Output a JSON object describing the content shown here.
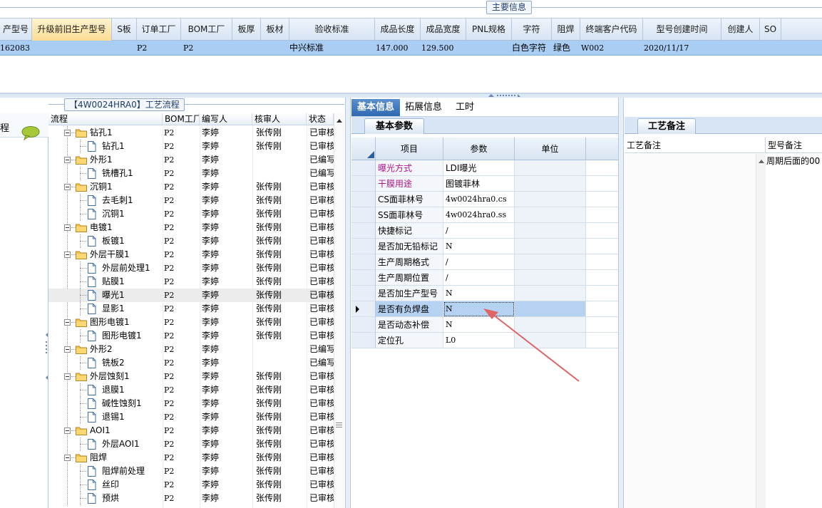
{
  "main_info": {
    "title": "主要信息",
    "columns": [
      {
        "label": "产型号"
      },
      {
        "label": "升级前旧生产型号"
      },
      {
        "label": "S板"
      },
      {
        "label": "订单工厂"
      },
      {
        "label": "BOM工厂"
      },
      {
        "label": "板厚"
      },
      {
        "label": "板材"
      },
      {
        "label": "验收标准"
      },
      {
        "label": "成品长度"
      },
      {
        "label": "成品宽度"
      },
      {
        "label": "PNL规格"
      },
      {
        "label": "字符"
      },
      {
        "label": "阻焊"
      },
      {
        "label": "终端客户代码"
      },
      {
        "label": "型号创建时间"
      },
      {
        "label": "创建人"
      },
      {
        "label": "SO"
      }
    ],
    "row": [
      "162083",
      "",
      "",
      "P2",
      "P2",
      "",
      "",
      "中兴标准",
      "147.000",
      "129.500",
      "",
      "白色字符",
      "绿色",
      "W002",
      "2020/11/17",
      "",
      ""
    ]
  },
  "left_panel": {
    "label": "程"
  },
  "process_flow": {
    "title": "【4W0024HRA0】工艺流程",
    "headers": [
      "流程",
      "BOM工厂",
      "编写人",
      "核审人",
      "状态"
    ],
    "rows": [
      {
        "name": "钻孔1",
        "level": 0,
        "bom": "P2",
        "writer": "李婷",
        "reviewer": "张传刚",
        "status": "已审核"
      },
      {
        "name": "钻孔1",
        "level": 1,
        "bom": "P2",
        "writer": "李婷",
        "reviewer": "张传刚",
        "status": "已审核"
      },
      {
        "name": "外形1",
        "level": 0,
        "bom": "P2",
        "writer": "李婷",
        "reviewer": "",
        "status": "已编写"
      },
      {
        "name": "铣槽孔1",
        "level": 1,
        "bom": "P2",
        "writer": "李婷",
        "reviewer": "",
        "status": "已编写"
      },
      {
        "name": "沉铜1",
        "level": 0,
        "bom": "P2",
        "writer": "李婷",
        "reviewer": "张传刚",
        "status": "已审核"
      },
      {
        "name": "去毛刺1",
        "level": 1,
        "bom": "P2",
        "writer": "李婷",
        "reviewer": "张传刚",
        "status": "已审核"
      },
      {
        "name": "沉铜1",
        "level": 1,
        "bom": "P2",
        "writer": "李婷",
        "reviewer": "张传刚",
        "status": "已审核"
      },
      {
        "name": "电镀1",
        "level": 0,
        "bom": "P2",
        "writer": "李婷",
        "reviewer": "张传刚",
        "status": "已审核"
      },
      {
        "name": "板镀1",
        "level": 1,
        "bom": "P2",
        "writer": "李婷",
        "reviewer": "张传刚",
        "status": "已审核"
      },
      {
        "name": "外层干膜1",
        "level": 0,
        "bom": "P2",
        "writer": "李婷",
        "reviewer": "张传刚",
        "status": "已审核"
      },
      {
        "name": "外层前处理1",
        "level": 1,
        "bom": "P2",
        "writer": "李婷",
        "reviewer": "张传刚",
        "status": "已审核"
      },
      {
        "name": "贴膜1",
        "level": 1,
        "bom": "P2",
        "writer": "李婷",
        "reviewer": "张传刚",
        "status": "已审核"
      },
      {
        "name": "曝光1",
        "level": 1,
        "bom": "P2",
        "writer": "李婷",
        "reviewer": "张传刚",
        "status": "已审核",
        "selected": true
      },
      {
        "name": "显影1",
        "level": 1,
        "bom": "P2",
        "writer": "李婷",
        "reviewer": "张传刚",
        "status": "已审核"
      },
      {
        "name": "图形电镀1",
        "level": 0,
        "bom": "P2",
        "writer": "李婷",
        "reviewer": "张传刚",
        "status": "已审核"
      },
      {
        "name": "图形电镀1",
        "level": 1,
        "bom": "P2",
        "writer": "李婷",
        "reviewer": "张传刚",
        "status": "已审核"
      },
      {
        "name": "外形2",
        "level": 0,
        "bom": "P2",
        "writer": "李婷",
        "reviewer": "",
        "status": "已编写"
      },
      {
        "name": "铣板2",
        "level": 1,
        "bom": "P2",
        "writer": "李婷",
        "reviewer": "",
        "status": "已编写"
      },
      {
        "name": "外层蚀刻1",
        "level": 0,
        "bom": "P2",
        "writer": "李婷",
        "reviewer": "张传刚",
        "status": "已审核"
      },
      {
        "name": "退膜1",
        "level": 1,
        "bom": "P2",
        "writer": "李婷",
        "reviewer": "张传刚",
        "status": "已审核"
      },
      {
        "name": "碱性蚀刻1",
        "level": 1,
        "bom": "P2",
        "writer": "李婷",
        "reviewer": "张传刚",
        "status": "已审核"
      },
      {
        "name": "退锡1",
        "level": 1,
        "bom": "P2",
        "writer": "李婷",
        "reviewer": "张传刚",
        "status": "已审核"
      },
      {
        "name": "AOI1",
        "level": 0,
        "bom": "P2",
        "writer": "李婷",
        "reviewer": "张传刚",
        "status": "已审核"
      },
      {
        "name": "外层AOI1",
        "level": 1,
        "bom": "P2",
        "writer": "李婷",
        "reviewer": "张传刚",
        "status": "已审核"
      },
      {
        "name": "阻焊",
        "level": 0,
        "bom": "P2",
        "writer": "李婷",
        "reviewer": "张传刚",
        "status": "已审核"
      },
      {
        "name": "阻焊前处理",
        "level": 1,
        "bom": "P2",
        "writer": "李婷",
        "reviewer": "张传刚",
        "status": "已审核"
      },
      {
        "name": "丝印",
        "level": 1,
        "bom": "P2",
        "writer": "李婷",
        "reviewer": "张传刚",
        "status": "已审核"
      },
      {
        "name": "预烘",
        "level": 1,
        "bom": "P2",
        "writer": "李婷",
        "reviewer": "张传刚",
        "status": "已审核"
      }
    ]
  },
  "info_tabs": [
    "基本信息",
    "拓展信息",
    "工时"
  ],
  "basic_params": {
    "tab": "基本参数",
    "headers": [
      "项目",
      "参数",
      "单位"
    ],
    "rows": [
      {
        "item": "曝光方式",
        "value": "LDI曝光",
        "unit": "",
        "highlight": true
      },
      {
        "item": "干膜用途",
        "value": "图镀菲林",
        "unit": "",
        "highlight": true
      },
      {
        "item": "CS面菲林号",
        "value": "4w0024hra0.cs",
        "unit": ""
      },
      {
        "item": "SS面菲林号",
        "value": "4w0024hra0.ss",
        "unit": ""
      },
      {
        "item": "快捷标记",
        "value": "/",
        "unit": ""
      },
      {
        "item": "是否加无铅标记",
        "value": "N",
        "unit": ""
      },
      {
        "item": "生产周期格式",
        "value": "/",
        "unit": ""
      },
      {
        "item": "生产周期位置",
        "value": "/",
        "unit": ""
      },
      {
        "item": "是否加生产型号",
        "value": "N",
        "unit": ""
      },
      {
        "item": "是否有负焊盘",
        "value": "N",
        "unit": "",
        "selected": true
      },
      {
        "item": "是否动态补偿",
        "value": "N",
        "unit": ""
      },
      {
        "item": "定位孔",
        "value": "L0",
        "unit": ""
      }
    ]
  },
  "remarks": {
    "tab": "工艺备注",
    "headers": [
      "工艺备注",
      "型号备注"
    ],
    "model_note": "周期后面的00"
  },
  "colors": {
    "highlight_label": "#b0168c",
    "annotation_arrow": "#e06464",
    "selection": "#a9cdf3"
  }
}
